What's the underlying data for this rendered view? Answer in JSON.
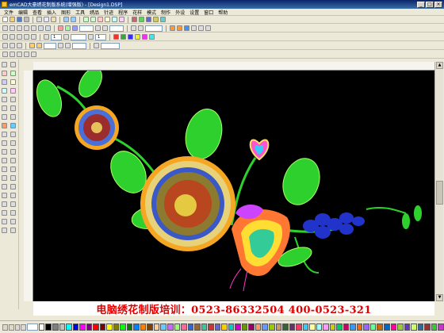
{
  "window": {
    "title": "emCAD大豪绣花制版系统(增强版) - [Design1.DSP]",
    "minimize": "_",
    "maximize": "□",
    "close": "×"
  },
  "menu": [
    "文件",
    "编辑",
    "查看",
    "插入",
    "图形",
    "工具",
    "绣品",
    "针迹",
    "程序",
    "花样",
    "模式",
    "制作",
    "外设",
    "设置",
    "窗口",
    "帮助"
  ],
  "toolbar2": {
    "combo1": "",
    "combo2": "",
    "combo3": ""
  },
  "toolbar3": {
    "combo1": "1",
    "combo2": "",
    "combo3": "1"
  },
  "toolbar4": {
    "combo1": "",
    "combo2": "",
    "combo3": ""
  },
  "banner": {
    "text": "电脑绣花制版培训：0523-86332504   400-0523-321"
  },
  "palette": {
    "colors": [
      "#ffffff",
      "#000000",
      "#808080",
      "#c0c0c0",
      "#00ffff",
      "#0000ff",
      "#ff00ff",
      "#800080",
      "#ff0000",
      "#800000",
      "#ffff00",
      "#808000",
      "#00ff00",
      "#008000",
      "#0080ff",
      "#ff8000",
      "#804000",
      "#ffcc99",
      "#66ccff",
      "#cc66ff",
      "#99ff66",
      "#ff6699",
      "#3366cc",
      "#996633",
      "#33cc99",
      "#cc3333",
      "#6666cc",
      "#ffcc00",
      "#00cccc",
      "#cc00cc",
      "#669900",
      "#990066",
      "#ff9966",
      "#6699ff",
      "#99cc00",
      "#cc9966",
      "#336633",
      "#663366",
      "#ff3366",
      "#33ccff",
      "#ffff99",
      "#99ffff",
      "#ff99ff",
      "#cccc00",
      "#00cc66",
      "#cc0066",
      "#3399ff",
      "#ff6600",
      "#9966ff",
      "#66ff99",
      "#cc6600",
      "#0066cc",
      "#ff0099",
      "#99cc33",
      "#6633cc",
      "#ccff66",
      "#336699",
      "#993333",
      "#33cc33",
      "#cc33cc"
    ],
    "combo": ""
  },
  "icons": {
    "app": "emcad-app-icon",
    "toolbar": [
      "new-icon",
      "open-icon",
      "save-icon",
      "print-icon",
      "cut-icon",
      "copy-icon",
      "paste-icon",
      "undo-icon",
      "redo-icon",
      "zoom-in-icon",
      "zoom-out-icon",
      "select-icon",
      "move-icon",
      "rotate-icon",
      "mirror-icon",
      "scale-icon",
      "stitch-icon",
      "fill-icon",
      "color-icon",
      "view-icon",
      "help-icon"
    ]
  }
}
